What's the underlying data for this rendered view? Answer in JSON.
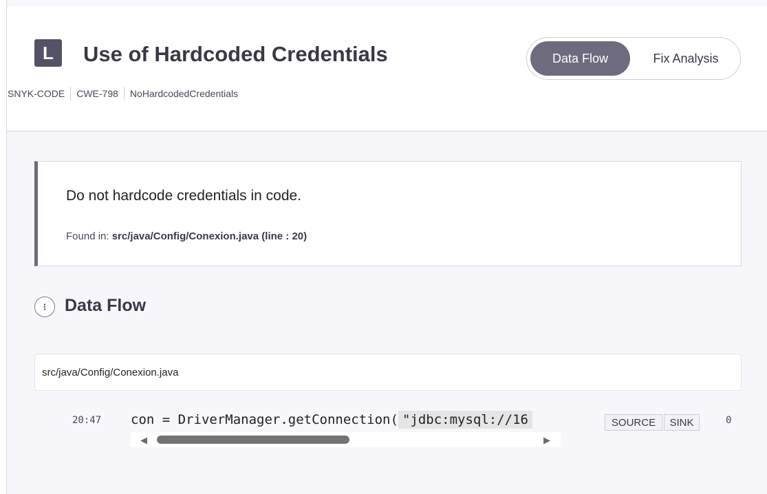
{
  "issue": {
    "severity_letter": "L",
    "title": "Use of Hardcoded Credentials",
    "meta": [
      "SNYK-CODE",
      "CWE-798",
      "NoHardcodedCredentials"
    ]
  },
  "toggle": {
    "data_flow_label": "Data Flow",
    "fix_analysis_label": "Fix Analysis",
    "active": "Data Flow"
  },
  "description": {
    "message": "Do not hardcode credentials in code.",
    "found_label": "Found in:",
    "found_location": "src/java/Config/Conexion.java (line : 20)"
  },
  "data_flow": {
    "heading": "Data Flow",
    "file": "src/java/Config/Conexion.java",
    "steps": [
      {
        "line_col": "20:47",
        "code_prefix": "con = DriverManager.getConnection(",
        "code_highlight": "\"jdbc:mysql://16",
        "tags": [
          "SOURCE",
          "SINK"
        ],
        "index": "0"
      }
    ]
  },
  "colors": {
    "accent": "#6e6b7f",
    "badge": "#545266",
    "background": "#f7f6fa"
  }
}
